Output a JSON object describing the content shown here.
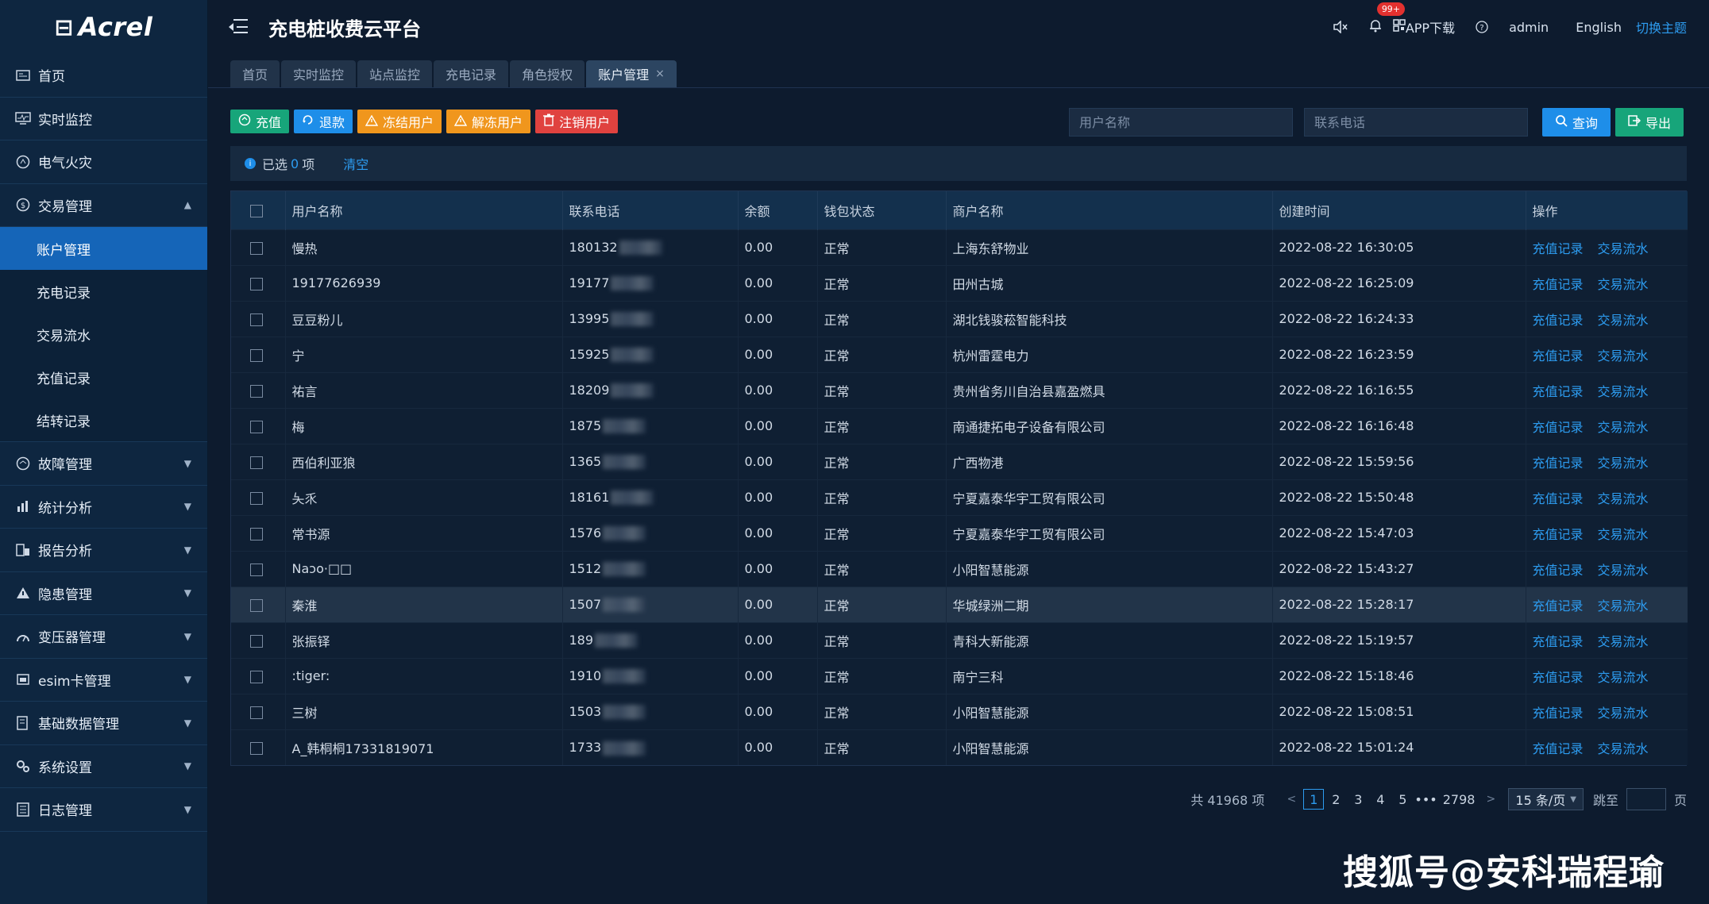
{
  "app": {
    "logo": "Acrel",
    "title": "充电桩收费云平台"
  },
  "header": {
    "badge": "99+",
    "app_download": "APP下载",
    "user": "admin",
    "language": "English",
    "theme": "切换主题"
  },
  "sidebar": {
    "items": [
      {
        "label": "首页",
        "icon": "home-icon"
      },
      {
        "label": "实时监控",
        "icon": "monitor-icon"
      },
      {
        "label": "电气火灾",
        "icon": "fire-icon"
      },
      {
        "label": "交易管理",
        "icon": "transaction-icon",
        "expanded": true
      },
      {
        "label": "故障管理",
        "icon": "fault-icon"
      },
      {
        "label": "统计分析",
        "icon": "chart-icon"
      },
      {
        "label": "报告分析",
        "icon": "report-icon"
      },
      {
        "label": "隐患管理",
        "icon": "warning-icon"
      },
      {
        "label": "变压器管理",
        "icon": "transformer-icon"
      },
      {
        "label": "esim卡管理",
        "icon": "sim-icon"
      },
      {
        "label": "基础数据管理",
        "icon": "database-icon"
      },
      {
        "label": "系统设置",
        "icon": "gear-icon"
      },
      {
        "label": "日志管理",
        "icon": "log-icon"
      }
    ],
    "sub_items": [
      "账户管理",
      "充电记录",
      "交易流水",
      "充值记录",
      "结转记录"
    ]
  },
  "tabs": [
    {
      "label": "首页"
    },
    {
      "label": "实时监控"
    },
    {
      "label": "站点监控"
    },
    {
      "label": "充电记录"
    },
    {
      "label": "角色授权"
    },
    {
      "label": "账户管理",
      "active": true
    }
  ],
  "toolbar": {
    "recharge": "充值",
    "refund": "退款",
    "freeze": "冻结用户",
    "unfreeze": "解冻用户",
    "cancel": "注销用户"
  },
  "search": {
    "username_placeholder": "用户名称",
    "phone_placeholder": "联系电话",
    "query": "查询",
    "export": "导出"
  },
  "selection": {
    "prefix": "已选",
    "count": "0",
    "suffix": "项",
    "clear": "清空"
  },
  "table": {
    "columns": [
      "用户名称",
      "联系电话",
      "余额",
      "钱包状态",
      "商户名称",
      "创建时间",
      "操作"
    ],
    "op_recharge": "充值记录",
    "op_trade": "交易流水",
    "rows": [
      {
        "name": "慢热",
        "phone": "180132",
        "balance": "0.00",
        "status": "正常",
        "merchant": "上海东舒物业",
        "time": "2022-08-22 16:30:05"
      },
      {
        "name": "19177626939",
        "phone": "19177",
        "balance": "0.00",
        "status": "正常",
        "merchant": "田州古城",
        "time": "2022-08-22 16:25:09"
      },
      {
        "name": "豆豆粉儿",
        "phone": "13995",
        "balance": "0.00",
        "status": "正常",
        "merchant": "湖北钱骏菘智能科技",
        "time": "2022-08-22 16:24:33"
      },
      {
        "name": "宁",
        "phone": "15925",
        "balance": "0.00",
        "status": "正常",
        "merchant": "杭州雷霆电力",
        "time": "2022-08-22 16:23:59"
      },
      {
        "name": "祐言",
        "phone": "18209",
        "balance": "0.00",
        "status": "正常",
        "merchant": "贵州省务川自治县嘉盈燃具",
        "time": "2022-08-22 16:16:55"
      },
      {
        "name": "梅",
        "phone": "1875",
        "balance": "0.00",
        "status": "正常",
        "merchant": "南通捷拓电子设备有限公司",
        "time": "2022-08-22 16:16:48"
      },
      {
        "name": "西伯利亚狼",
        "phone": "1365",
        "balance": "0.00",
        "status": "正常",
        "merchant": "广西物港",
        "time": "2022-08-22 15:59:56"
      },
      {
        "name": "夨乑",
        "phone": "18161",
        "balance": "0.00",
        "status": "正常",
        "merchant": "宁夏嘉泰华宇工贸有限公司",
        "time": "2022-08-22 15:50:48"
      },
      {
        "name": "常书源",
        "phone": "1576",
        "balance": "0.00",
        "status": "正常",
        "merchant": "宁夏嘉泰华宇工贸有限公司",
        "time": "2022-08-22 15:47:03"
      },
      {
        "name": "Naɔo·□□",
        "phone": "1512",
        "balance": "0.00",
        "status": "正常",
        "merchant": "小阳智慧能源",
        "time": "2022-08-22 15:43:27"
      },
      {
        "name": "秦淮",
        "phone": "1507",
        "balance": "0.00",
        "status": "正常",
        "merchant": "华城绿洲二期",
        "time": "2022-08-22 15:28:17",
        "highlight": true
      },
      {
        "name": "张振铎",
        "phone": "189",
        "balance": "0.00",
        "status": "正常",
        "merchant": "青科大新能源",
        "time": "2022-08-22 15:19:57"
      },
      {
        "name": ":tiger:",
        "phone": "1910",
        "balance": "0.00",
        "status": "正常",
        "merchant": "南宁三科",
        "time": "2022-08-22 15:18:46"
      },
      {
        "name": "三树",
        "phone": "1503",
        "balance": "0.00",
        "status": "正常",
        "merchant": "小阳智慧能源",
        "time": "2022-08-22 15:08:51"
      },
      {
        "name": "A_韩桐桐17331819071",
        "phone": "1733",
        "balance": "0.00",
        "status": "正常",
        "merchant": "小阳智慧能源",
        "time": "2022-08-22 15:01:24"
      }
    ]
  },
  "pagination": {
    "total": "共 41968 项",
    "pages": [
      "1",
      "2",
      "3",
      "4",
      "5"
    ],
    "ellipsis": "•••",
    "last": "2798",
    "page_size": "15 条/页",
    "jump_label": "跳至",
    "jump_suffix": "页"
  },
  "watermark": "搜狐号@安科瑞程瑜",
  "colors": {
    "accent": "#2d9cf0",
    "active_nav": "#1565b8",
    "green": "#17a57a",
    "orange": "#f0961d",
    "red": "#e0423f"
  }
}
